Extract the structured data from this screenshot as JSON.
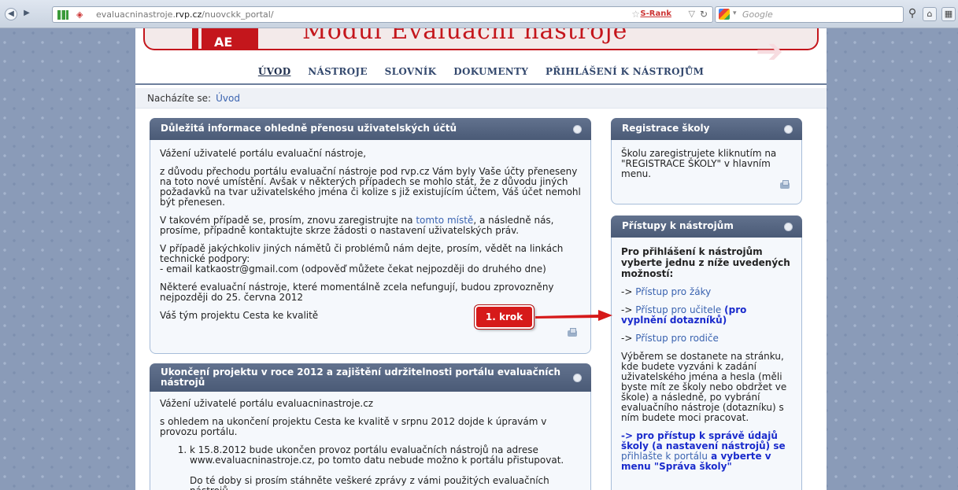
{
  "browser": {
    "url_prefix": "evaluacninastroje.",
    "url_domain": "rvp.cz",
    "url_path": "/nuovckk_portal/",
    "srank": "S-Rank",
    "search_placeholder": "Google"
  },
  "header": {
    "banner_title": "Modul Evaluační nástroje",
    "logo_text": "AE"
  },
  "menu": [
    {
      "label": "ÚVOD"
    },
    {
      "label": "NÁSTROJE"
    },
    {
      "label": "SLOVNÍK"
    },
    {
      "label": "DOKUMENTY"
    },
    {
      "label": "PŘIHLÁŠENÍ K NÁSTROJŮM"
    }
  ],
  "breadcrumb": {
    "label": "Nacházíte se:",
    "current": "Úvod"
  },
  "info_box": {
    "title": "Důležitá informace ohledně přenosu uživatelských účtů",
    "greeting": "Vážení uživatelé portálu evaluační nástroje,",
    "p1": "z důvodu přechodu portálu evaluační nástroje pod rvp.cz Vám byly Vaše účty přeneseny na toto nové umístění. Avšak v některých případech se mohlo stát, že z důvodu jiných požadavků na tvar uživatelského jména či kolize s již existujícím účtem, Váš účet nemohl být přenesen.",
    "p2_before": "V takovém případě se, prosím, znovu zaregistrujte na ",
    "p2_link": "tomto místě",
    "p2_after": ", a následně nás, prosíme, případně kontaktujte skrze žádosti o nastavení uživatelských práv.",
    "p3": "V případě jakýchkoliv jiných námětů či problémů nám dejte, prosím, vědět na linkách technické podpory:",
    "p3_email": "- email katkaostr@gmail.com (odpověď můžete čekat nejpozději do druhého dne)",
    "p4": "Některé evaluační nástroje, které momentálně zcela nefungují, budou zprovozněny nejpozději do 25. června 2012",
    "signature": "Váš tým projektu Cesta ke kvalitě"
  },
  "end_box": {
    "title": "Ukončení projektu v roce 2012 a zajištění udržitelnosti portálu evaluačních nástrojů",
    "greeting": "Vážení uživatelé portálu evaluacninastroje.cz",
    "p1": "s ohledem na ukončení projektu Cesta ke kvalitě v srpnu 2012 dojde k úpravám v provozu portálu.",
    "item1": "k 15.8.2012 bude ukončen provoz portálu evaluačních nástrojů na adrese www.evaluacninastroje.cz, po tomto datu nebude možno k portálu přistupovat.",
    "item1_sub": "Do té doby si prosím stáhněte veškeré zprávy z vámi použitých evaluačních nástrojů."
  },
  "reg_box": {
    "title": "Registrace školy",
    "text": "Školu zaregistrujete kliknutím na \"REGISTRACE ŠKOLY\" v hlavním menu."
  },
  "access_box": {
    "title": "Přístupy k nástrojům",
    "intro": "Pro přihlášení k nástrojům vyberte jednu z níže uvedených možností:",
    "arrow": "->",
    "pupils": "Přístup pro žáky",
    "teachers": "Přístup pro učitele",
    "teachers_note": "(pro vyplnění dotazníků)",
    "parents": "Přístup pro rodiče",
    "desc": "Výběrem se dostanete na stránku, kde budete vyzváni k zadání uživatelského jména a hesla (měli byste mít ze školy nebo obdržet ve škole) a následně, po vybrání evaluačního nástroje (dotazníku) s ním budete moci pracovat.",
    "admin_before": "-> pro přístup k správě údajů školy (a nastavení nástrojů) se ",
    "admin_link": "přihlašte k portálu",
    "admin_after": " a vyberte v menu \"Správa školy\""
  },
  "annotation": {
    "label": "1. krok",
    "color": "#d61a1a"
  }
}
